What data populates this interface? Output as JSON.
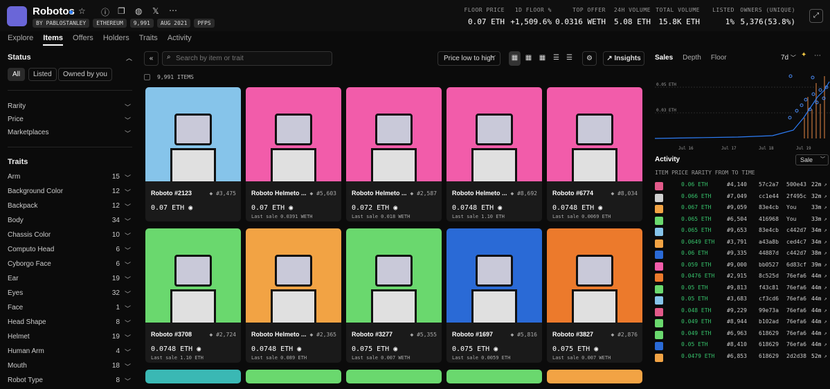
{
  "collection": {
    "name": "Robotos",
    "badges": [
      "BY PABLOSTANLEY",
      "ETHEREUM",
      "9,991",
      "AUG 2021",
      "PFPS"
    ],
    "icon": "robot-logo"
  },
  "stats": [
    {
      "label": "FLOOR PRICE",
      "value": "0.07 ETH"
    },
    {
      "label": "1D FLOOR %",
      "value": "+1,509.6%"
    },
    {
      "label": "TOP OFFER",
      "value": "0.0316 WETH"
    },
    {
      "label": "24H VOLUME",
      "value": "5.08 ETH"
    },
    {
      "label": "TOTAL VOLUME",
      "value": "15.8K ETH"
    },
    {
      "label": "LISTED",
      "value": "1%"
    },
    {
      "label": "OWNERS (UNIQUE)",
      "value": "5,376(53.8%)"
    }
  ],
  "tabs": [
    "Explore",
    "Items",
    "Offers",
    "Holders",
    "Traits",
    "Activity"
  ],
  "sidebar": {
    "status_title": "Status",
    "status_options": [
      "All",
      "Listed",
      "Owned by you"
    ],
    "filters": [
      "Rarity",
      "Price",
      "Marketplaces"
    ],
    "traits_title": "Traits",
    "traits": [
      {
        "name": "Arm",
        "count": "15"
      },
      {
        "name": "Background Color",
        "count": "12"
      },
      {
        "name": "Backpack",
        "count": "12"
      },
      {
        "name": "Body",
        "count": "34"
      },
      {
        "name": "Chassis Color",
        "count": "10"
      },
      {
        "name": "Computo Head",
        "count": "6"
      },
      {
        "name": "Cyborgo Face",
        "count": "6"
      },
      {
        "name": "Ear",
        "count": "19"
      },
      {
        "name": "Eyes",
        "count": "32"
      },
      {
        "name": "Face",
        "count": "1"
      },
      {
        "name": "Head Shape",
        "count": "8"
      },
      {
        "name": "Helmet",
        "count": "19"
      },
      {
        "name": "Human Arm",
        "count": "4"
      },
      {
        "name": "Mouth",
        "count": "18"
      },
      {
        "name": "Robot Type",
        "count": "8"
      }
    ]
  },
  "toolbar": {
    "search_placeholder": "Search by item or trait",
    "sort": "Price low to high",
    "insights": "Insights",
    "items_count": "9,991 ITEMS"
  },
  "items": [
    {
      "name": "Roboto #2123",
      "rank": "#3,475",
      "price": "0.07 ETH",
      "last": "",
      "bg": "#86c4ea"
    },
    {
      "name": "Roboto Helmeto ...",
      "rank": "#5,603",
      "price": "0.07 ETH",
      "last": "Last sale 0.0391 WETH",
      "bg": "#f25caa"
    },
    {
      "name": "Roboto Helmeto ...",
      "rank": "#2,587",
      "price": "0.072 ETH",
      "last": "Last sale 0.018 WETH",
      "bg": "#f25caa"
    },
    {
      "name": "Roboto Helmeto ...",
      "rank": "#8,692",
      "price": "0.0748 ETH",
      "last": "Last sale 1.10 ETH",
      "bg": "#f25caa"
    },
    {
      "name": "Roboto #6774",
      "rank": "#8,034",
      "price": "0.0748 ETH",
      "last": "Last sale 0.0069 ETH",
      "bg": "#f25caa"
    },
    {
      "name": "Roboto #3708",
      "rank": "#2,724",
      "price": "0.0748 ETH",
      "last": "Last sale 1.10 ETH",
      "bg": "#6ad86e"
    },
    {
      "name": "Roboto Helmeto ...",
      "rank": "#2,365",
      "price": "0.0748 ETH",
      "last": "Last sale 0.089 ETH",
      "bg": "#f2a344"
    },
    {
      "name": "Roboto #3277",
      "rank": "#5,355",
      "price": "0.075 ETH",
      "last": "Last sale 0.007 WETH",
      "bg": "#6ad86e"
    },
    {
      "name": "Roboto #1697",
      "rank": "#5,816",
      "price": "0.075 ETH",
      "last": "Last sale 0.0059 ETH",
      "bg": "#2a6ad6"
    },
    {
      "name": "Roboto #3827",
      "rank": "#2,876",
      "price": "0.075 ETH",
      "last": "Last sale 0.007 WETH",
      "bg": "#ec7a2c"
    }
  ],
  "right": {
    "tabs": [
      "Sales",
      "Depth",
      "Floor"
    ],
    "range": "7d",
    "chart_ticks": {
      "y": [
        "0.05 ETH",
        "0.03 ETH"
      ],
      "x": [
        "Jul 16",
        "Jul 17",
        "Jul 18",
        "Jul 19"
      ]
    },
    "activity_title": "Activity",
    "activity_filter": "Sale",
    "headers": [
      "ITEM",
      "PRICE",
      "RARITY",
      "FROM",
      "TO",
      "TIME"
    ],
    "rows": [
      {
        "price": "0.06 ETH",
        "rarity": "#4,140",
        "from": "57c2a7",
        "to": "500e43",
        "time": "22m",
        "c": "#e25a8a"
      },
      {
        "price": "0.066 ETH",
        "rarity": "#7,049",
        "from": "cc1e44",
        "to": "2f495c",
        "time": "32m",
        "c": "#d0d0d0"
      },
      {
        "price": "0.067 ETH",
        "rarity": "#9,059",
        "from": "83e4cb",
        "to": "You",
        "time": "33m",
        "c": "#f2a344"
      },
      {
        "price": "0.065 ETH",
        "rarity": "#6,504",
        "from": "416968",
        "to": "You",
        "time": "33m",
        "c": "#6ad86e"
      },
      {
        "price": "0.065 ETH",
        "rarity": "#9,653",
        "from": "83e4cb",
        "to": "c442d7",
        "time": "34m",
        "c": "#86c4ea"
      },
      {
        "price": "0.0649 ETH",
        "rarity": "#3,791",
        "from": "a43a8b",
        "to": "ced4c7",
        "time": "34m",
        "c": "#f2a344"
      },
      {
        "price": "0.06 ETH",
        "rarity": "#9,335",
        "from": "44887d",
        "to": "c442d7",
        "time": "38m",
        "c": "#2a6ad6"
      },
      {
        "price": "0.059 ETH",
        "rarity": "#9,000",
        "from": "bb0527",
        "to": "6d83cf",
        "time": "39m",
        "c": "#f25caa"
      },
      {
        "price": "0.0476 ETH",
        "rarity": "#2,915",
        "from": "8c525d",
        "to": "76efa6",
        "time": "44m",
        "c": "#ec7a2c"
      },
      {
        "price": "0.05 ETH",
        "rarity": "#9,813",
        "from": "f43c81",
        "to": "76efa6",
        "time": "44m",
        "c": "#6ad86e"
      },
      {
        "price": "0.05 ETH",
        "rarity": "#3,683",
        "from": "cf3cd6",
        "to": "76efa6",
        "time": "44m",
        "c": "#86c4ea"
      },
      {
        "price": "0.048 ETH",
        "rarity": "#9,229",
        "from": "99e73a",
        "to": "76efa6",
        "time": "44m",
        "c": "#e25a8a"
      },
      {
        "price": "0.049 ETH",
        "rarity": "#8,944",
        "from": "b102ad",
        "to": "76efa6",
        "time": "44m",
        "c": "#6ad86e"
      },
      {
        "price": "0.049 ETH",
        "rarity": "#6,963",
        "from": "618629",
        "to": "76efa6",
        "time": "44m",
        "c": "#6ad86e"
      },
      {
        "price": "0.05 ETH",
        "rarity": "#8,410",
        "from": "618629",
        "to": "76efa6",
        "time": "44m",
        "c": "#2a6ad6"
      },
      {
        "price": "0.0479 ETH",
        "rarity": "#6,853",
        "from": "618629",
        "to": "2d2d38",
        "time": "52m",
        "c": "#f2a344"
      }
    ]
  }
}
